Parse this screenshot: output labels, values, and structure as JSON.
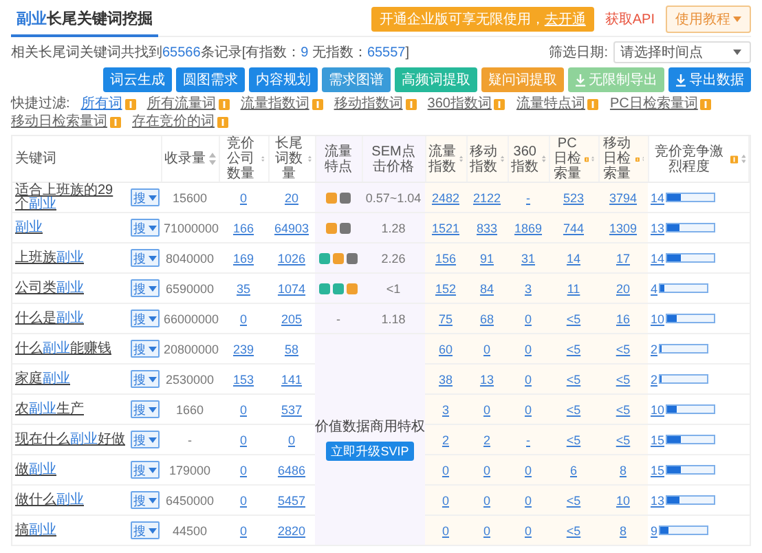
{
  "tab": {
    "parts": [
      {
        "text": "副业",
        "highlight": true
      },
      {
        "text": "长尾关键词挖掘",
        "highlight": false
      }
    ],
    "selected": true
  },
  "promo_banner": {
    "text": "开通企业版可享无限使用，",
    "link": "去开通"
  },
  "api_link": "获取API",
  "tutorial_button": "使用教程",
  "summary": [
    {
      "text": "相关长尾词关键词共找到",
      "highlight": false
    },
    {
      "text": "65566",
      "highlight": true
    },
    {
      "text": "条记录[有指数：",
      "highlight": false
    },
    {
      "text": "9",
      "highlight": true
    },
    {
      "text": " 无指数：",
      "highlight": false
    },
    {
      "text": "65557",
      "highlight": true
    },
    {
      "text": "]",
      "highlight": false
    }
  ],
  "date_filter": {
    "label": "筛选日期:",
    "placeholder": "请选择时间点"
  },
  "toolbar_buttons": [
    {
      "label": "词云生成",
      "color": "#1e88e5",
      "has_icon": false
    },
    {
      "label": "圆图需求",
      "color": "#1e88e5",
      "has_icon": false
    },
    {
      "label": "内容规划",
      "color": "#1e88e5",
      "has_icon": false
    },
    {
      "label": "需求图谱",
      "color": "#3a9bd9",
      "has_icon": false
    },
    {
      "label": "高频词提取",
      "color": "#26b99a",
      "has_icon": false
    },
    {
      "label": "疑问词提取",
      "color": "#f0a030",
      "has_icon": false
    },
    {
      "label": "无限制导出",
      "color": "#8fd39a",
      "has_icon": true
    },
    {
      "label": "导出数据",
      "color": "#1e88e5",
      "has_icon": true
    }
  ],
  "filter_label": "快捷过滤:",
  "filters": [
    {
      "label": "所有词",
      "selected": true
    },
    {
      "label": "所有流量词",
      "selected": false
    },
    {
      "label": "流量指数词",
      "selected": false
    },
    {
      "label": "移动指数词",
      "selected": false
    },
    {
      "label": "360指数词",
      "selected": false
    },
    {
      "label": "流量特点词",
      "selected": false
    },
    {
      "label": "PC日检索量词",
      "selected": false
    },
    {
      "label": "移动日检索量词",
      "selected": false
    },
    {
      "label": "存在竞价的词",
      "selected": false
    }
  ],
  "columns": [
    {
      "label": "关键词",
      "kind": "keyword",
      "sortable": false,
      "info": false
    },
    {
      "label": "收录量",
      "kind": "count",
      "link": false,
      "sortable": true,
      "info": false
    },
    {
      "label": "竞价公司数量",
      "kind": "count",
      "link": true,
      "sortable": true,
      "info": false
    },
    {
      "label": "长尾词数量",
      "kind": "count",
      "link": true,
      "sortable": true,
      "info": false
    },
    {
      "label": "流量特点",
      "kind": "tags",
      "sortable": false,
      "info": false
    },
    {
      "label": "SEM点击价格",
      "kind": "price",
      "sortable": false,
      "info": false
    },
    {
      "label": "流量指数",
      "kind": "index",
      "sortable": true,
      "info": false
    },
    {
      "label": "移动指数",
      "kind": "index",
      "sortable": true,
      "info": false
    },
    {
      "label": "360指数",
      "kind": "index",
      "sortable": true,
      "info": false
    },
    {
      "label": "PC日检索量",
      "kind": "index",
      "sortable": true,
      "info": true
    },
    {
      "label": "移动日检索量",
      "kind": "index",
      "sortable": true,
      "info": true
    },
    {
      "label": "竞价竞争激烈程度",
      "kind": "bar",
      "sortable": true,
      "info": true
    }
  ],
  "locked_panel": {
    "text": "价值数据商用特权",
    "button": "立即升级SVIP"
  },
  "rows": [
    {
      "keyword": [
        {
          "text": "适合上班族的29个",
          "highlight": false
        },
        {
          "text": "副业",
          "highlight": true
        }
      ],
      "search_button": "搜",
      "counts": [
        "15600",
        "0",
        "20"
      ],
      "traffic_tags": [
        {
          "color": "#f0a030"
        },
        {
          "color": "#777777"
        }
      ],
      "sem_price": "0.57~1.04",
      "indices": [
        "2482",
        "2122",
        "-",
        "523",
        "3794"
      ],
      "competition": "14",
      "level": 0.28
    },
    {
      "keyword": [
        {
          "text": "副业",
          "highlight": true
        }
      ],
      "search_button": "搜",
      "counts": [
        "71000000",
        "166",
        "64903"
      ],
      "traffic_tags": [
        {
          "color": "#f0a030"
        },
        {
          "color": "#777777"
        }
      ],
      "sem_price": "1.28",
      "indices": [
        "1521",
        "833",
        "1869",
        "744",
        "1309"
      ],
      "competition": "13",
      "level": 0.26
    },
    {
      "keyword": [
        {
          "text": "上班族",
          "highlight": false
        },
        {
          "text": "副业",
          "highlight": true
        }
      ],
      "search_button": "搜",
      "counts": [
        "8040000",
        "169",
        "1026"
      ],
      "traffic_tags": [
        {
          "color": "#2bb59a"
        },
        {
          "color": "#f0a030"
        },
        {
          "color": "#777777"
        }
      ],
      "sem_price": "2.26",
      "indices": [
        "156",
        "91",
        "31",
        "14",
        "17"
      ],
      "competition": "14",
      "level": 0.28
    },
    {
      "keyword": [
        {
          "text": "公司类",
          "highlight": false
        },
        {
          "text": "副业",
          "highlight": true
        }
      ],
      "search_button": "搜",
      "counts": [
        "6590000",
        "35",
        "1074"
      ],
      "traffic_tags": [
        {
          "color": "#2bb59a"
        },
        {
          "color": "#2bb59a"
        },
        {
          "color": "#f0a030"
        }
      ],
      "sem_price": "<1",
      "indices": [
        "152",
        "84",
        "3",
        "11",
        "20"
      ],
      "competition": "4",
      "level": 0.08
    },
    {
      "keyword": [
        {
          "text": "什么是",
          "highlight": false
        },
        {
          "text": "副业",
          "highlight": true
        }
      ],
      "search_button": "搜",
      "counts": [
        "66000000",
        "0",
        "205"
      ],
      "traffic_placeholder": "-",
      "sem_price": "1.18",
      "indices": [
        "75",
        "68",
        "0",
        "<5",
        "16"
      ],
      "competition": "10",
      "level": 0.2
    },
    {
      "keyword": [
        {
          "text": "什么",
          "highlight": false
        },
        {
          "text": "副业",
          "highlight": true
        },
        {
          "text": "能赚钱",
          "highlight": false
        }
      ],
      "search_button": "搜",
      "counts": [
        "20800000",
        "239",
        "58"
      ],
      "indices": [
        "60",
        "0",
        "0",
        "<5",
        "<5"
      ],
      "competition": "2",
      "level": 0.04
    },
    {
      "keyword": [
        {
          "text": "家庭",
          "highlight": false
        },
        {
          "text": "副业",
          "highlight": true
        }
      ],
      "search_button": "搜",
      "counts": [
        "2530000",
        "153",
        "141"
      ],
      "indices": [
        "38",
        "13",
        "0",
        "<5",
        "<5"
      ],
      "competition": "2",
      "level": 0.04
    },
    {
      "keyword": [
        {
          "text": "农",
          "highlight": false
        },
        {
          "text": "副业",
          "highlight": true
        },
        {
          "text": "生产",
          "highlight": false
        }
      ],
      "search_button": "搜",
      "counts": [
        "1660",
        "0",
        "537"
      ],
      "indices": [
        "3",
        "0",
        "0",
        "<5",
        "<5"
      ],
      "competition": "10",
      "level": 0.2
    },
    {
      "keyword": [
        {
          "text": "现在什么",
          "highlight": false
        },
        {
          "text": "副业",
          "highlight": true
        },
        {
          "text": "好做",
          "highlight": false
        }
      ],
      "search_button": "搜",
      "counts": [
        "-",
        "0",
        "0"
      ],
      "indices": [
        "2",
        "2",
        "-",
        "<5",
        "<5"
      ],
      "competition": "15",
      "level": 0.3
    },
    {
      "keyword": [
        {
          "text": "做",
          "highlight": false
        },
        {
          "text": "副业",
          "highlight": true
        }
      ],
      "search_button": "搜",
      "counts": [
        "179000",
        "0",
        "6486"
      ],
      "indices": [
        "0",
        "0",
        "0",
        "6",
        "8"
      ],
      "competition": "15",
      "level": 0.3
    },
    {
      "keyword": [
        {
          "text": "做什么",
          "highlight": false
        },
        {
          "text": "副业",
          "highlight": true
        }
      ],
      "search_button": "搜",
      "counts": [
        "6450000",
        "0",
        "5457"
      ],
      "indices": [
        "0",
        "0",
        "0",
        "<5",
        "10"
      ],
      "competition": "13",
      "level": 0.26
    },
    {
      "keyword": [
        {
          "text": "搞",
          "highlight": false
        },
        {
          "text": "副业",
          "highlight": true
        }
      ],
      "search_button": "搜",
      "counts": [
        "44500",
        "0",
        "2820"
      ],
      "indices": [
        "0",
        "0",
        "0",
        "<5",
        "8"
      ],
      "competition": "9",
      "level": 0.18
    }
  ]
}
